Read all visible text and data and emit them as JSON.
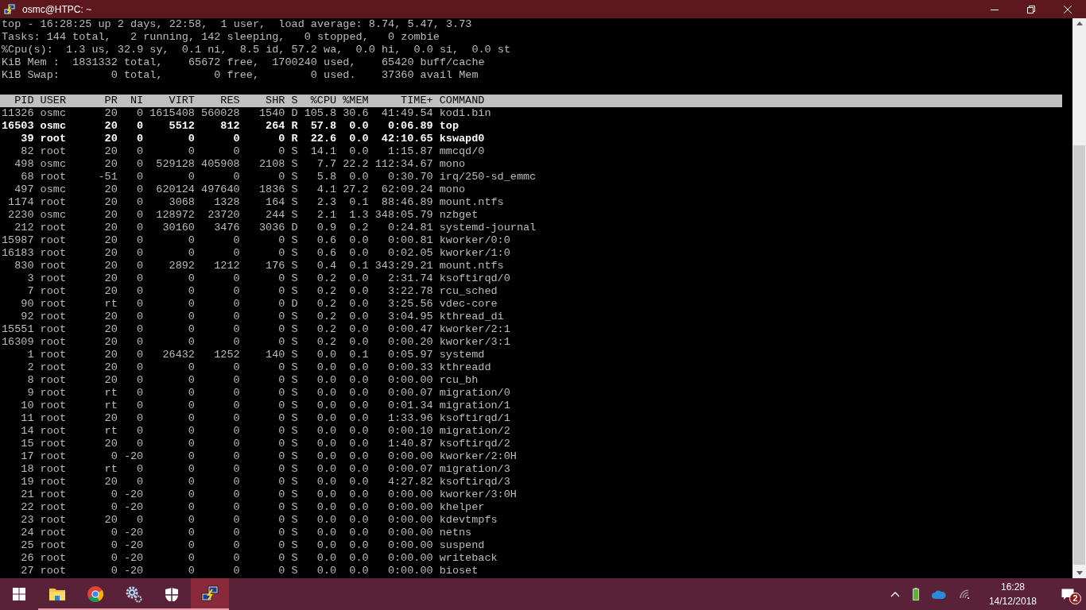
{
  "window": {
    "title": "osmc@HTPC: ~"
  },
  "summary": [
    "top - 16:28:25 up 2 days, 22:58,  1 user,  load average: 8.74, 5.47, 3.73",
    "Tasks: 144 total,   2 running, 142 sleeping,   0 stopped,   0 zombie",
    "%Cpu(s):  1.3 us, 32.9 sy,  0.1 ni,  8.5 id, 57.2 wa,  0.0 hi,  0.0 si,  0.0 st",
    "KiB Mem :  1831332 total,    65672 free,  1700240 used,    65420 buff/cache",
    "KiB Swap:        0 total,        0 free,        0 used.    37360 avail Mem"
  ],
  "table": {
    "columns": [
      "PID",
      "USER",
      "PR",
      "NI",
      "VIRT",
      "RES",
      "SHR",
      "S",
      "%CPU",
      "%MEM",
      "TIME+",
      "COMMAND"
    ],
    "rows": [
      {
        "bold": false,
        "cells": [
          "11326",
          "osmc",
          "20",
          "0",
          "1615408",
          "560028",
          "1540",
          "D",
          "105.8",
          "30.6",
          "41:49.54",
          "kodi.bin"
        ]
      },
      {
        "bold": true,
        "cells": [
          "16503",
          "osmc",
          "20",
          "0",
          "5512",
          "812",
          "264",
          "R",
          "57.8",
          "0.0",
          "0:06.89",
          "top"
        ]
      },
      {
        "bold": true,
        "cells": [
          "39",
          "root",
          "20",
          "0",
          "0",
          "0",
          "0",
          "R",
          "22.6",
          "0.0",
          "42:10.65",
          "kswapd0"
        ]
      },
      {
        "bold": false,
        "cells": [
          "82",
          "root",
          "20",
          "0",
          "0",
          "0",
          "0",
          "S",
          "14.1",
          "0.0",
          "1:15.87",
          "mmcqd/0"
        ]
      },
      {
        "bold": false,
        "cells": [
          "498",
          "osmc",
          "20",
          "0",
          "529128",
          "405908",
          "2108",
          "S",
          "7.7",
          "22.2",
          "112:34.67",
          "mono"
        ]
      },
      {
        "bold": false,
        "cells": [
          "68",
          "root",
          "-51",
          "0",
          "0",
          "0",
          "0",
          "S",
          "5.8",
          "0.0",
          "0:30.70",
          "irq/250-sd_emmc"
        ]
      },
      {
        "bold": false,
        "cells": [
          "497",
          "osmc",
          "20",
          "0",
          "620124",
          "497640",
          "1836",
          "S",
          "4.1",
          "27.2",
          "62:09.24",
          "mono"
        ]
      },
      {
        "bold": false,
        "cells": [
          "1174",
          "root",
          "20",
          "0",
          "3068",
          "1328",
          "164",
          "S",
          "2.3",
          "0.1",
          "88:46.89",
          "mount.ntfs"
        ]
      },
      {
        "bold": false,
        "cells": [
          "2230",
          "osmc",
          "20",
          "0",
          "128972",
          "23720",
          "244",
          "S",
          "2.1",
          "1.3",
          "348:05.79",
          "nzbget"
        ]
      },
      {
        "bold": false,
        "cells": [
          "212",
          "root",
          "20",
          "0",
          "30160",
          "3476",
          "3036",
          "D",
          "0.9",
          "0.2",
          "0:24.81",
          "systemd-journal"
        ]
      },
      {
        "bold": false,
        "cells": [
          "15987",
          "root",
          "20",
          "0",
          "0",
          "0",
          "0",
          "S",
          "0.6",
          "0.0",
          "0:00.81",
          "kworker/0:0"
        ]
      },
      {
        "bold": false,
        "cells": [
          "16183",
          "root",
          "20",
          "0",
          "0",
          "0",
          "0",
          "S",
          "0.6",
          "0.0",
          "0:02.05",
          "kworker/1:0"
        ]
      },
      {
        "bold": false,
        "cells": [
          "830",
          "root",
          "20",
          "0",
          "2892",
          "1212",
          "176",
          "S",
          "0.4",
          "0.1",
          "343:29.21",
          "mount.ntfs"
        ]
      },
      {
        "bold": false,
        "cells": [
          "3",
          "root",
          "20",
          "0",
          "0",
          "0",
          "0",
          "S",
          "0.2",
          "0.0",
          "2:31.74",
          "ksoftirqd/0"
        ]
      },
      {
        "bold": false,
        "cells": [
          "7",
          "root",
          "20",
          "0",
          "0",
          "0",
          "0",
          "S",
          "0.2",
          "0.0",
          "3:22.78",
          "rcu_sched"
        ]
      },
      {
        "bold": false,
        "cells": [
          "90",
          "root",
          "rt",
          "0",
          "0",
          "0",
          "0",
          "D",
          "0.2",
          "0.0",
          "3:25.56",
          "vdec-core"
        ]
      },
      {
        "bold": false,
        "cells": [
          "92",
          "root",
          "20",
          "0",
          "0",
          "0",
          "0",
          "S",
          "0.2",
          "0.0",
          "3:04.95",
          "kthread_di"
        ]
      },
      {
        "bold": false,
        "cells": [
          "15551",
          "root",
          "20",
          "0",
          "0",
          "0",
          "0",
          "S",
          "0.2",
          "0.0",
          "0:00.47",
          "kworker/2:1"
        ]
      },
      {
        "bold": false,
        "cells": [
          "16309",
          "root",
          "20",
          "0",
          "0",
          "0",
          "0",
          "S",
          "0.2",
          "0.0",
          "0:00.20",
          "kworker/3:1"
        ]
      },
      {
        "bold": false,
        "cells": [
          "1",
          "root",
          "20",
          "0",
          "26432",
          "1252",
          "140",
          "S",
          "0.0",
          "0.1",
          "0:05.97",
          "systemd"
        ]
      },
      {
        "bold": false,
        "cells": [
          "2",
          "root",
          "20",
          "0",
          "0",
          "0",
          "0",
          "S",
          "0.0",
          "0.0",
          "0:00.33",
          "kthreadd"
        ]
      },
      {
        "bold": false,
        "cells": [
          "8",
          "root",
          "20",
          "0",
          "0",
          "0",
          "0",
          "S",
          "0.0",
          "0.0",
          "0:00.00",
          "rcu_bh"
        ]
      },
      {
        "bold": false,
        "cells": [
          "9",
          "root",
          "rt",
          "0",
          "0",
          "0",
          "0",
          "S",
          "0.0",
          "0.0",
          "0:00.07",
          "migration/0"
        ]
      },
      {
        "bold": false,
        "cells": [
          "10",
          "root",
          "rt",
          "0",
          "0",
          "0",
          "0",
          "S",
          "0.0",
          "0.0",
          "0:01.34",
          "migration/1"
        ]
      },
      {
        "bold": false,
        "cells": [
          "11",
          "root",
          "20",
          "0",
          "0",
          "0",
          "0",
          "S",
          "0.0",
          "0.0",
          "1:33.96",
          "ksoftirqd/1"
        ]
      },
      {
        "bold": false,
        "cells": [
          "14",
          "root",
          "rt",
          "0",
          "0",
          "0",
          "0",
          "S",
          "0.0",
          "0.0",
          "0:00.10",
          "migration/2"
        ]
      },
      {
        "bold": false,
        "cells": [
          "15",
          "root",
          "20",
          "0",
          "0",
          "0",
          "0",
          "S",
          "0.0",
          "0.0",
          "1:40.87",
          "ksoftirqd/2"
        ]
      },
      {
        "bold": false,
        "cells": [
          "17",
          "root",
          "0",
          "-20",
          "0",
          "0",
          "0",
          "S",
          "0.0",
          "0.0",
          "0:00.00",
          "kworker/2:0H"
        ]
      },
      {
        "bold": false,
        "cells": [
          "18",
          "root",
          "rt",
          "0",
          "0",
          "0",
          "0",
          "S",
          "0.0",
          "0.0",
          "0:00.07",
          "migration/3"
        ]
      },
      {
        "bold": false,
        "cells": [
          "19",
          "root",
          "20",
          "0",
          "0",
          "0",
          "0",
          "S",
          "0.0",
          "0.0",
          "4:27.82",
          "ksoftirqd/3"
        ]
      },
      {
        "bold": false,
        "cells": [
          "21",
          "root",
          "0",
          "-20",
          "0",
          "0",
          "0",
          "S",
          "0.0",
          "0.0",
          "0:00.00",
          "kworker/3:0H"
        ]
      },
      {
        "bold": false,
        "cells": [
          "22",
          "root",
          "0",
          "-20",
          "0",
          "0",
          "0",
          "S",
          "0.0",
          "0.0",
          "0:00.00",
          "khelper"
        ]
      },
      {
        "bold": false,
        "cells": [
          "23",
          "root",
          "20",
          "0",
          "0",
          "0",
          "0",
          "S",
          "0.0",
          "0.0",
          "0:00.00",
          "kdevtmpfs"
        ]
      },
      {
        "bold": false,
        "cells": [
          "24",
          "root",
          "0",
          "-20",
          "0",
          "0",
          "0",
          "S",
          "0.0",
          "0.0",
          "0:00.00",
          "netns"
        ]
      },
      {
        "bold": false,
        "cells": [
          "25",
          "root",
          "0",
          "-20",
          "0",
          "0",
          "0",
          "S",
          "0.0",
          "0.0",
          "0:00.00",
          "suspend"
        ]
      },
      {
        "bold": false,
        "cells": [
          "26",
          "root",
          "0",
          "-20",
          "0",
          "0",
          "0",
          "S",
          "0.0",
          "0.0",
          "0:00.00",
          "writeback"
        ]
      },
      {
        "bold": false,
        "cells": [
          "27",
          "root",
          "0",
          "-20",
          "0",
          "0",
          "0",
          "S",
          "0.0",
          "0.0",
          "0:00.00",
          "bioset"
        ]
      }
    ]
  },
  "taskbar": {
    "apps": [
      {
        "kind": "start",
        "running": false,
        "selected": false
      },
      {
        "kind": "folder",
        "running": true,
        "selected": false
      },
      {
        "kind": "browser",
        "running": true,
        "selected": false
      },
      {
        "kind": "gears",
        "running": true,
        "selected": false
      },
      {
        "kind": "shield",
        "running": true,
        "selected": false
      },
      {
        "kind": "terminal",
        "running": true,
        "selected": true
      }
    ],
    "time": "16:28",
    "date": "14/12/2018",
    "notifications": "2"
  }
}
